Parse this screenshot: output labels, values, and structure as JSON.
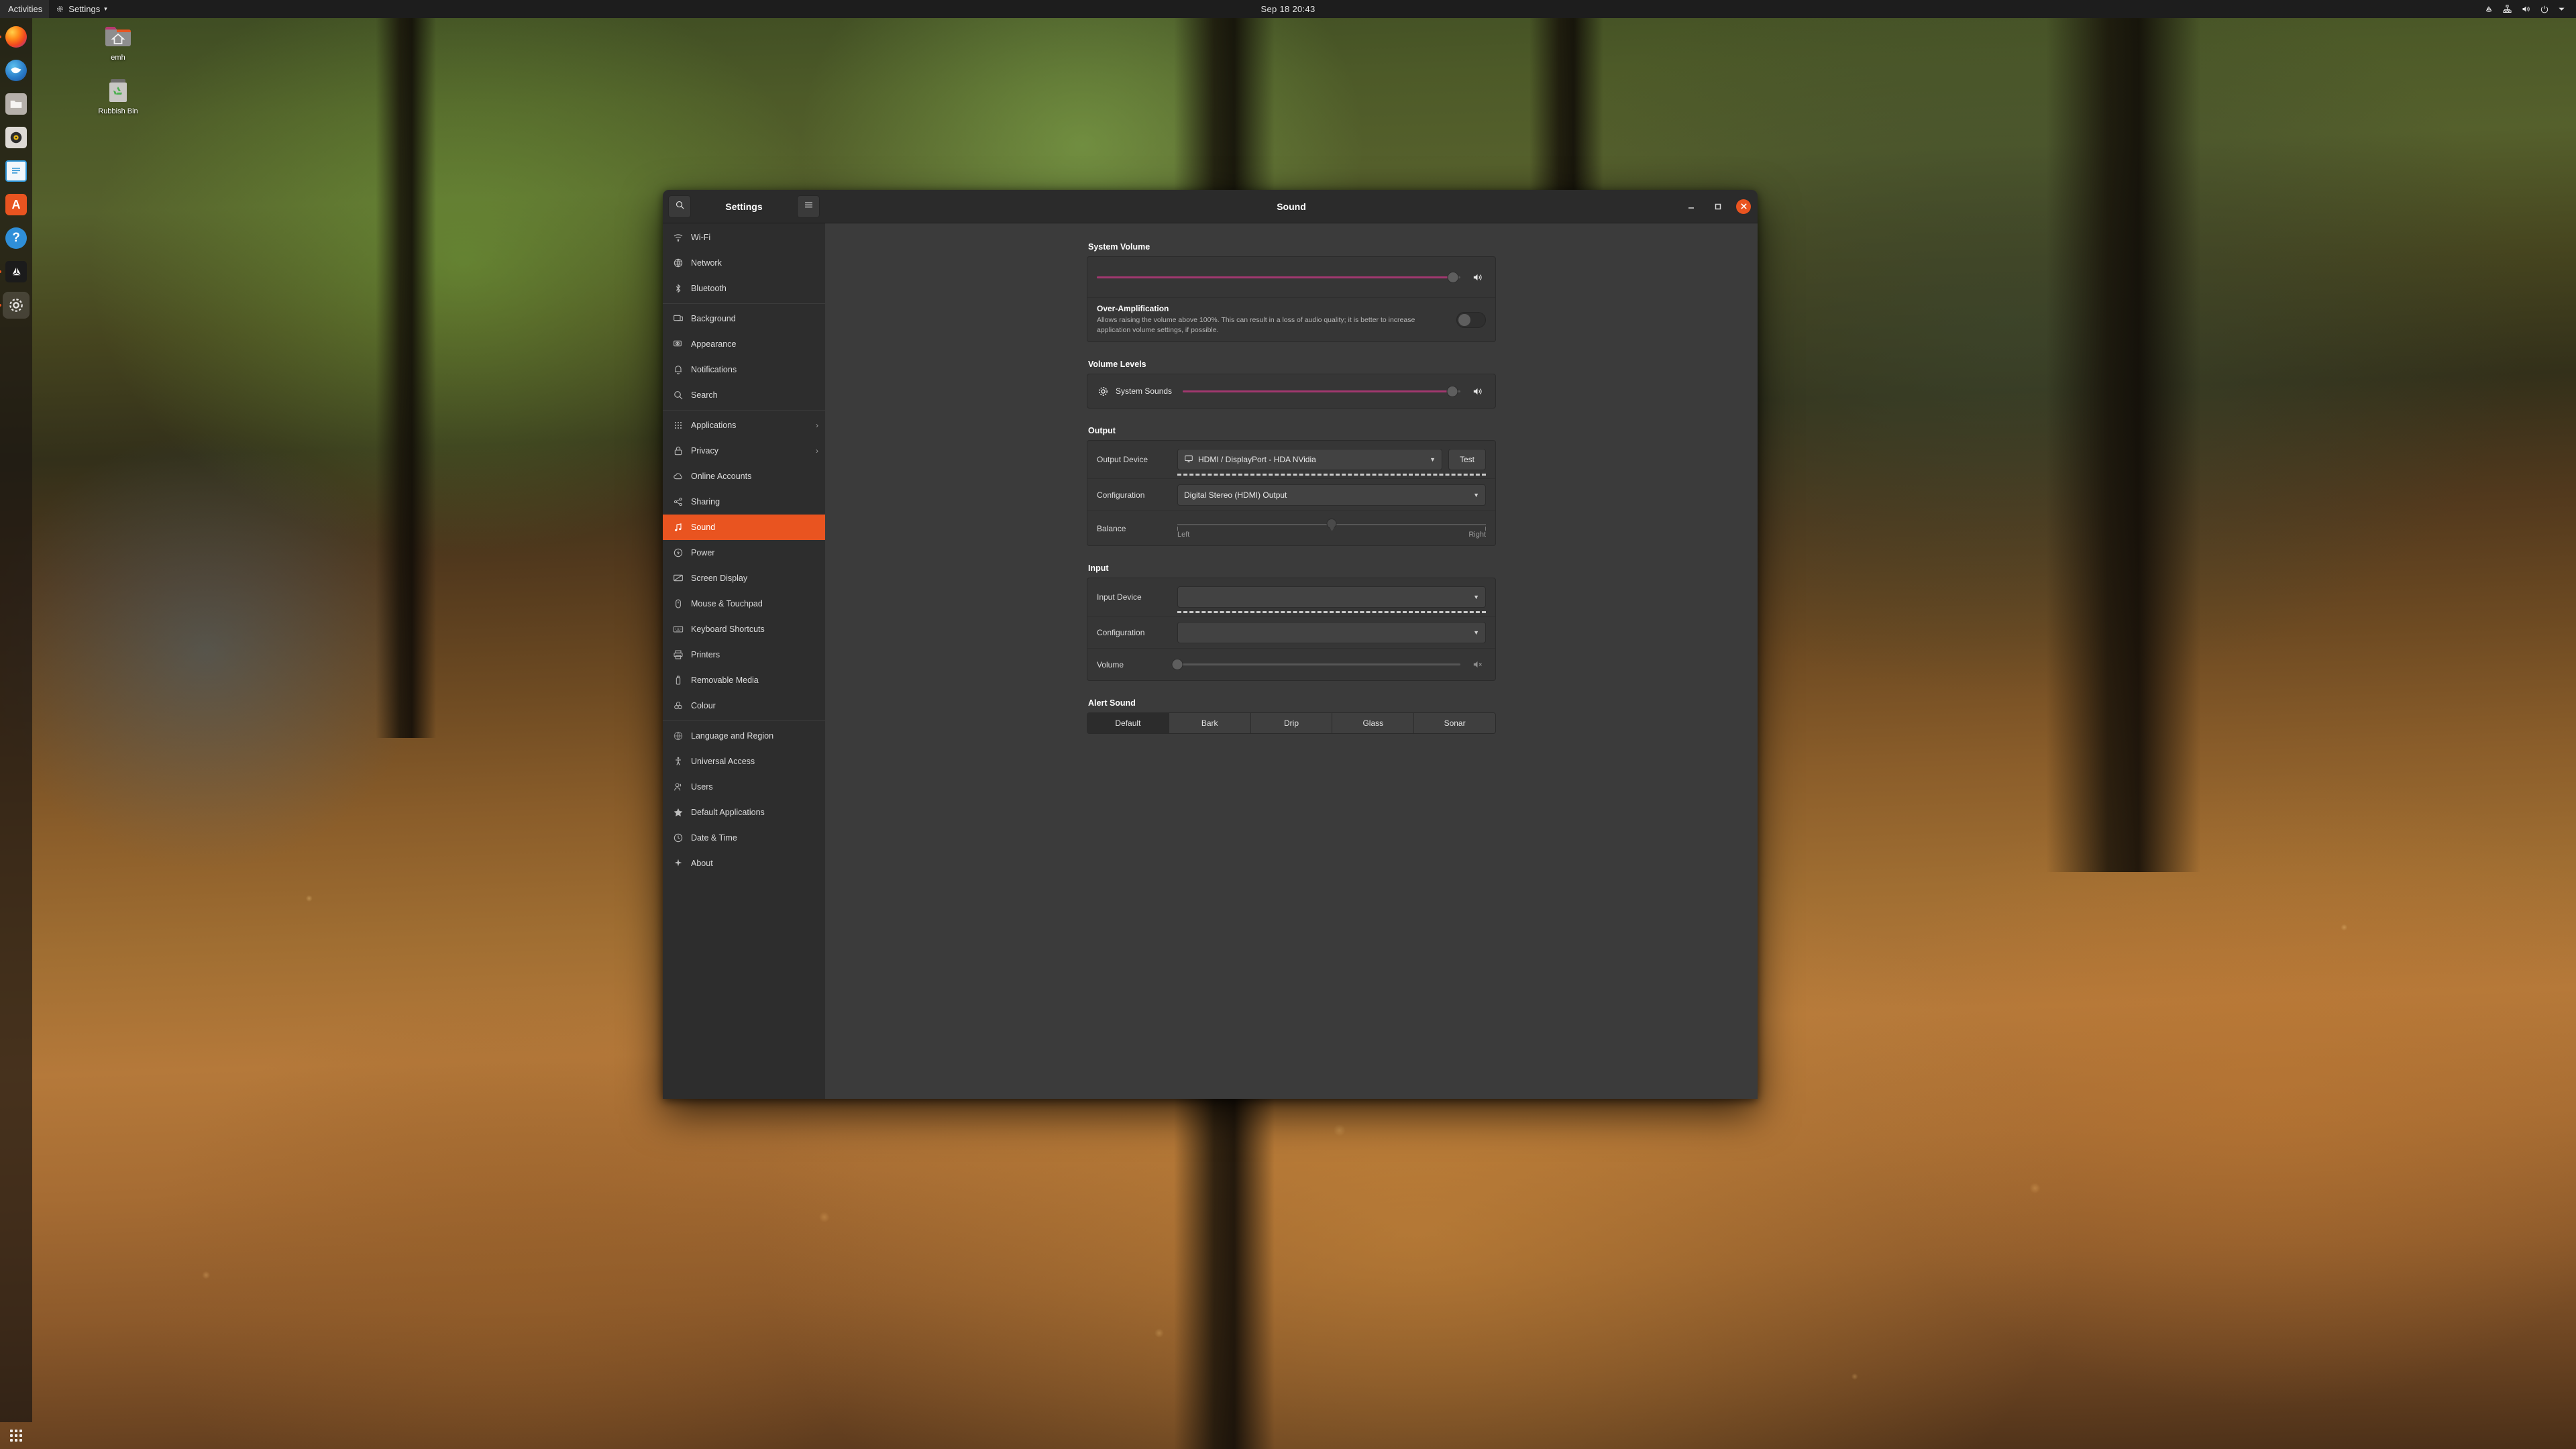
{
  "topbar": {
    "activities": "Activities",
    "app_menu": "Settings",
    "app_menu_icon": "gear-icon",
    "app_menu_caret": "▾",
    "clock": "Sep 18  20:43",
    "status_icons": [
      "unity-icon",
      "network-icon",
      "volume-icon",
      "power-icon",
      "chevron-down-icon"
    ]
  },
  "dock": {
    "items": [
      {
        "name": "firefox",
        "label": "Firefox",
        "running": true,
        "active": false
      },
      {
        "name": "thunderbird",
        "label": "Thunderbird",
        "running": false,
        "active": false
      },
      {
        "name": "files",
        "label": "Files",
        "running": false,
        "active": false
      },
      {
        "name": "rhythmbox",
        "label": "Rhythmbox",
        "running": false,
        "active": false
      },
      {
        "name": "libreoffice-writer",
        "label": "LibreOffice Writer",
        "running": false,
        "active": false
      },
      {
        "name": "ubuntu-software",
        "label": "Ubuntu Software",
        "running": false,
        "active": false
      },
      {
        "name": "help",
        "label": "Help",
        "running": false,
        "active": false
      },
      {
        "name": "unity",
        "label": "Unity",
        "running": true,
        "active": false
      },
      {
        "name": "settings",
        "label": "Settings",
        "running": true,
        "active": true
      }
    ],
    "show_applications": "Show Applications"
  },
  "desktop_icons": [
    {
      "name": "home-folder",
      "label": "emh",
      "icon": "home-folder-icon"
    },
    {
      "name": "rubbish-bin",
      "label": "Rubbish Bin",
      "icon": "trash-icon"
    }
  ],
  "window": {
    "title": "Sound",
    "sidebar_title": "Settings",
    "search_icon": "search-icon",
    "menu_icon": "hamburger-menu-icon",
    "controls": {
      "minimize": "–",
      "maximize": "□",
      "close": "✕",
      "close_color": "#e95420"
    }
  },
  "sidebar": {
    "items": [
      {
        "label": "Wi-Fi",
        "icon": "wifi-icon",
        "selected": false,
        "submenu": false
      },
      {
        "label": "Network",
        "icon": "network-globe-icon",
        "selected": false,
        "submenu": false
      },
      {
        "label": "Bluetooth",
        "icon": "bluetooth-icon",
        "selected": false,
        "submenu": false
      },
      {
        "separator": true
      },
      {
        "label": "Background",
        "icon": "background-icon",
        "selected": false,
        "submenu": false
      },
      {
        "label": "Appearance",
        "icon": "appearance-icon",
        "selected": false,
        "submenu": false
      },
      {
        "label": "Notifications",
        "icon": "bell-icon",
        "selected": false,
        "submenu": false
      },
      {
        "label": "Search",
        "icon": "search-icon",
        "selected": false,
        "submenu": false
      },
      {
        "separator": true
      },
      {
        "label": "Applications",
        "icon": "applications-grid-icon",
        "selected": false,
        "submenu": true
      },
      {
        "label": "Privacy",
        "icon": "lock-icon",
        "selected": false,
        "submenu": true
      },
      {
        "label": "Online Accounts",
        "icon": "cloud-icon",
        "selected": false,
        "submenu": false
      },
      {
        "label": "Sharing",
        "icon": "share-icon",
        "selected": false,
        "submenu": false
      },
      {
        "label": "Sound",
        "icon": "sound-note-icon",
        "selected": true,
        "submenu": false
      },
      {
        "label": "Power",
        "icon": "power-icon",
        "selected": false,
        "submenu": false
      },
      {
        "label": "Screen Display",
        "icon": "display-icon",
        "selected": false,
        "submenu": false
      },
      {
        "label": "Mouse & Touchpad",
        "icon": "mouse-icon",
        "selected": false,
        "submenu": false
      },
      {
        "label": "Keyboard Shortcuts",
        "icon": "keyboard-icon",
        "selected": false,
        "submenu": false
      },
      {
        "label": "Printers",
        "icon": "printer-icon",
        "selected": false,
        "submenu": false
      },
      {
        "label": "Removable Media",
        "icon": "usb-icon",
        "selected": false,
        "submenu": false
      },
      {
        "label": "Colour",
        "icon": "colour-icon",
        "selected": false,
        "submenu": false
      },
      {
        "separator": true
      },
      {
        "label": "Language and Region",
        "icon": "globe-icon",
        "selected": false,
        "submenu": false
      },
      {
        "label": "Universal Access",
        "icon": "accessibility-icon",
        "selected": false,
        "submenu": false
      },
      {
        "label": "Users",
        "icon": "users-icon",
        "selected": false,
        "submenu": false
      },
      {
        "label": "Default Applications",
        "icon": "star-icon",
        "selected": false,
        "submenu": false
      },
      {
        "label": "Date & Time",
        "icon": "clock-icon",
        "selected": false,
        "submenu": false
      },
      {
        "label": "About",
        "icon": "about-sparkle-icon",
        "selected": false,
        "submenu": false
      }
    ]
  },
  "sound": {
    "system_volume": {
      "title": "System Volume",
      "value_percent": 98,
      "speaker_icon": "volume-high-icon",
      "over_amplification": {
        "title": "Over-Amplification",
        "description": "Allows raising the volume above 100%. This can result in a loss of audio quality; it is better to increase application volume settings, if possible.",
        "enabled": false
      }
    },
    "volume_levels": {
      "title": "Volume Levels",
      "streams": [
        {
          "label": "System Sounds",
          "icon": "system-sounds-gear-icon",
          "value_percent": 97,
          "speaker_icon": "volume-high-icon"
        }
      ]
    },
    "output": {
      "title": "Output",
      "device_label": "Output Device",
      "device_value": "HDMI / DisplayPort - HDA NVidia",
      "device_icon": "monitor-icon",
      "test_label": "Test",
      "configuration_label": "Configuration",
      "configuration_value": "Digital Stereo (HDMI) Output",
      "balance_label": "Balance",
      "balance_left": "Left",
      "balance_right": "Right",
      "balance_value_percent": 50
    },
    "input": {
      "title": "Input",
      "device_label": "Input Device",
      "device_value": "",
      "configuration_label": "Configuration",
      "configuration_value": "",
      "volume_label": "Volume",
      "volume_value_percent": 0,
      "speaker_icon": "volume-muted-icon"
    },
    "alert_sound": {
      "title": "Alert Sound",
      "options": [
        "Default",
        "Bark",
        "Drip",
        "Glass",
        "Sonar"
      ],
      "selected": "Default"
    }
  }
}
